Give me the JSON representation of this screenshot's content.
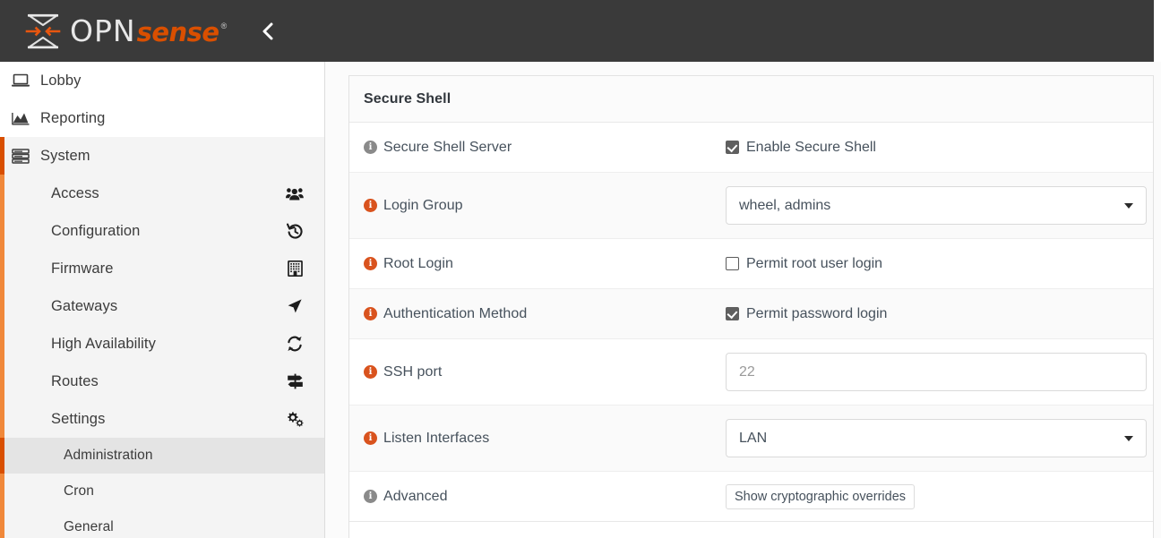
{
  "header": {
    "brand_opn": "OPN",
    "brand_sense": "sense",
    "brand_reg": "®",
    "logo_icon": "opnsense-logo-icon",
    "collapse_icon": "chevron-left-icon",
    "collapse_label": "Collapse menu"
  },
  "sidebar": {
    "top_items": [
      {
        "label": "Lobby",
        "icon": "laptop-icon",
        "active": false,
        "shaded": false
      },
      {
        "label": "Reporting",
        "icon": "area-chart-icon",
        "active": false,
        "shaded": false
      },
      {
        "label": "System",
        "icon": "server-stack-icon",
        "active": true,
        "shaded": true
      }
    ],
    "system_items": [
      {
        "label": "Access",
        "icon": "users-icon"
      },
      {
        "label": "Configuration",
        "icon": "history-icon"
      },
      {
        "label": "Firmware",
        "icon": "building-icon"
      },
      {
        "label": "Gateways",
        "icon": "location-arrow-icon"
      },
      {
        "label": "High Availability",
        "icon": "refresh-icon"
      },
      {
        "label": "Routes",
        "icon": "signpost-icon"
      },
      {
        "label": "Settings",
        "icon": "gears-icon"
      }
    ],
    "settings_items": [
      {
        "label": "Administration",
        "selected": true
      },
      {
        "label": "Cron",
        "selected": false
      },
      {
        "label": "General",
        "selected": false
      }
    ]
  },
  "main": {
    "panel_title": "Secure Shell",
    "rows": [
      {
        "label": "Secure Shell Server",
        "info": "gray",
        "control": "checkbox",
        "checked": true,
        "control_label": "Enable Secure Shell"
      },
      {
        "label": "Login Group",
        "info": "orange",
        "control": "select",
        "value": "wheel, admins"
      },
      {
        "label": "Root Login",
        "info": "orange",
        "control": "checkbox",
        "checked": false,
        "control_label": "Permit root user login"
      },
      {
        "label": "Authentication Method",
        "info": "orange",
        "control": "checkbox",
        "checked": true,
        "control_label": "Permit password login"
      },
      {
        "label": "SSH port",
        "info": "orange",
        "control": "input",
        "value": "",
        "placeholder": "22"
      },
      {
        "label": "Listen Interfaces",
        "info": "orange",
        "control": "select",
        "value": "LAN"
      },
      {
        "label": "Advanced",
        "info": "gray",
        "control": "button",
        "button_label": "Show cryptographic overrides"
      }
    ]
  },
  "colors": {
    "brand_orange": "#d94f00",
    "header_bg": "#3a3a3a",
    "accent_light_orange": "#f0883a",
    "info_orange": "#d9531e",
    "info_gray": "#8a8a8a"
  }
}
